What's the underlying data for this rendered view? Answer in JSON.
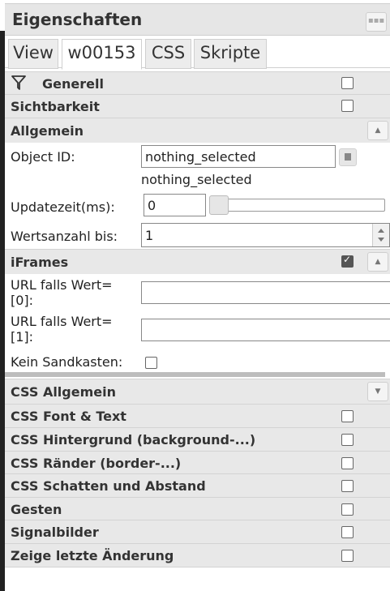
{
  "panel": {
    "title": "Eigenschaften",
    "tabs": [
      "View",
      "w00153",
      "CSS",
      "Skripte"
    ]
  },
  "groups": {
    "generell": "Generell",
    "sichtbarkeit": "Sichtbarkeit",
    "allgemein": "Allgemein",
    "iframes": "iFrames",
    "css_allgemein": "CSS Allgemein",
    "css_font": "CSS Font & Text",
    "css_hintergrund": "CSS Hintergrund (background-...)",
    "css_raender": "CSS Ränder (border-...)",
    "css_schatten": "CSS Schatten und Abstand",
    "gesten": "Gesten",
    "signalbilder": "Signalbilder",
    "letzte_aenderung": "Zeige letzte Änderung"
  },
  "fields": {
    "object_id_label": "Object ID:",
    "object_id_value": "nothing_selected",
    "object_id_hint": "nothing_selected",
    "updatezeit_label": "Updatezeit(ms):",
    "updatezeit_value": "0",
    "wertsanzahl_label": "Wertsanzahl bis:",
    "wertsanzahl_value": "1",
    "url0_label_line1": "URL falls Wert=",
    "url0_label_line2": "[0]:",
    "url0_value": "",
    "url1_label_line1": "URL falls Wert=",
    "url1_label_line2": "[1]:",
    "url1_value": "",
    "sandkasten_label": "Kein Sandkasten:"
  },
  "state": {
    "iframes_checked": true,
    "updatezeit_slider_fraction": 0
  }
}
